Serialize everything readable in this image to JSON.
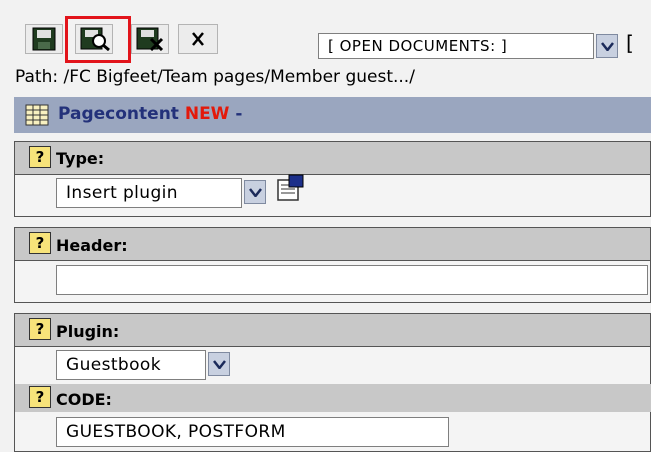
{
  "toolbar": {
    "buttons": [
      {
        "name": "save-icon"
      },
      {
        "name": "save-and-view-icon"
      },
      {
        "name": "save-and-close-icon"
      },
      {
        "name": "close-icon"
      }
    ],
    "open_documents_label": "[ OPEN DOCUMENTS: ]",
    "trailing_bracket": "["
  },
  "path": "Path: /FC Bigfeet/Team pages/Member guest.../",
  "pagecontent": {
    "title": "Pagecontent",
    "badge": "NEW",
    "suffix": "-"
  },
  "sections": {
    "type": {
      "label": "Type:",
      "value": "Insert plugin"
    },
    "header": {
      "label": "Header:",
      "value": ""
    },
    "plugin": {
      "label": "Plugin:",
      "value": "Guestbook"
    },
    "code": {
      "label": "CODE:",
      "value": "GUESTBOOK, POSTFORM"
    }
  },
  "help_glyph": "?",
  "colors": {
    "highlight": "#e2141b",
    "title_blue": "#23317a",
    "new_red": "#e3190b",
    "bar": "#9aa6bf"
  }
}
